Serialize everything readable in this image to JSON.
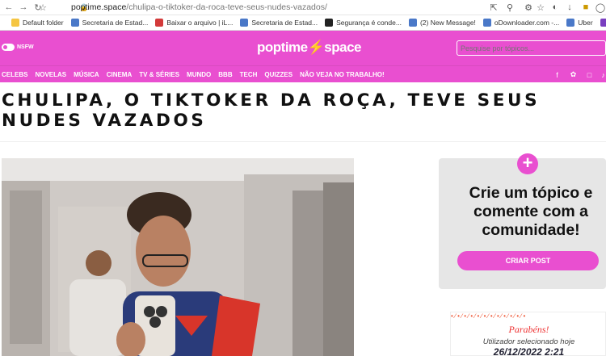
{
  "browser": {
    "url_domain": "poptime.space",
    "url_path": "/chulipa-o-tiktoker-da-roca-teve-seus-nudes-vazados/",
    "bookmarks": [
      {
        "label": "Default folder",
        "color": "#f5c542"
      },
      {
        "label": "Secretaria de Estad...",
        "color": "#4a78c8"
      },
      {
        "label": "Baixar o arquivo | iL...",
        "color": "#d33a3a"
      },
      {
        "label": "Secretaria de Estad...",
        "color": "#4a78c8"
      },
      {
        "label": "Segurança é conde...",
        "color": "#222222"
      },
      {
        "label": "(2) New Message!",
        "color": "#4a78c8"
      },
      {
        "label": "oDownloader.com -...",
        "color": "#4a78c8"
      },
      {
        "label": "Uber",
        "color": "#4a78c8"
      },
      {
        "label": "Carrinho d",
        "color": "#7a3fc0"
      }
    ]
  },
  "site": {
    "nsfw_label": "NSFW",
    "logo": "poptime⚡space",
    "search_placeholder": "Pesquise por tópicos...",
    "menu": [
      "CELEBS",
      "NOVELAS",
      "MÚSICA",
      "CINEMA",
      "TV & SÉRIES",
      "MUNDO",
      "BBB",
      "TECH",
      "QUIZZES",
      "NÃO VEJA NO TRABALHO!"
    ],
    "brand_color": "#e94fd0"
  },
  "article": {
    "title": "CHULIPA, O TIKTOKER DA ROÇA, TEVE SEUS NUDES VAZADOS"
  },
  "sidebar": {
    "plus": "+",
    "card_text": "Crie um tópico e comente com a comunidade!",
    "button": "CRIAR POST"
  },
  "ad": {
    "line1": "Parabéns!",
    "line2": "Utilizador selecionado hoje",
    "line3": "26/12/2022 2:21"
  }
}
